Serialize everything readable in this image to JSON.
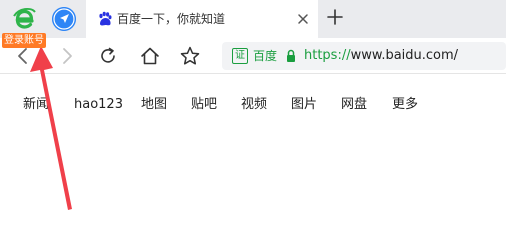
{
  "browser": {
    "logo_icon": "browser-e-logo-icon",
    "login_badge": "登录账号",
    "nav_icon": "navigation-compass-icon",
    "accent_green": "#1a9e3f",
    "badge_orange": "#ff7a25"
  },
  "tab": {
    "favicon": "baidu-paw-icon",
    "title": "百度一下，你就知道",
    "close_icon": "close-icon"
  },
  "new_tab_icon": "plus-icon",
  "toolbar": {
    "back_icon": "chevron-left-icon",
    "forward_icon": "chevron-right-icon",
    "reload_icon": "reload-icon",
    "home_icon": "home-icon",
    "favorite_icon": "star-icon"
  },
  "address": {
    "cert_glyph": "证",
    "cert_label": "百度",
    "lock_icon": "lock-icon",
    "scheme": "https://",
    "host": "www.baidu.com/"
  },
  "page_links": [
    "新闻",
    "hao123",
    "地图",
    "贴吧",
    "视频",
    "图片",
    "网盘",
    "更多"
  ],
  "annotation": {
    "arrow_color": "#f0404a"
  }
}
